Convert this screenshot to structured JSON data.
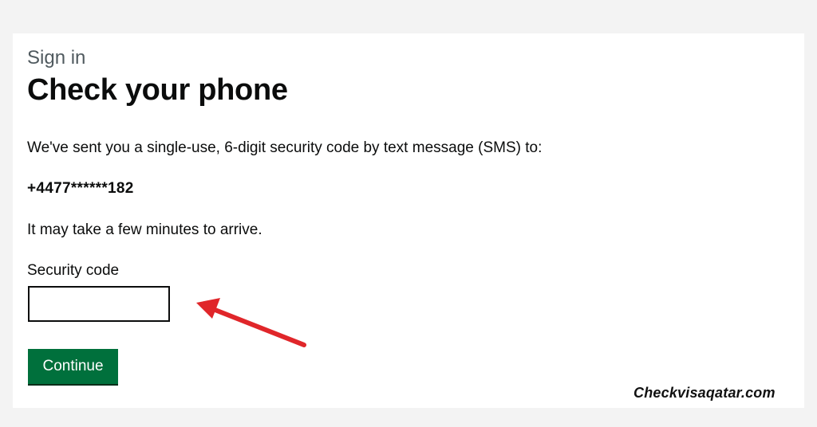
{
  "page": {
    "caption": "Sign in",
    "title": "Check your phone"
  },
  "message": {
    "lead": "We've sent you a single-use, 6-digit security code by text message (SMS) to:",
    "phone_number": "+4477******182",
    "note": "It may take a few minutes to arrive."
  },
  "form": {
    "code_label": "Security code",
    "code_value": "",
    "continue_label": "Continue"
  },
  "annotation": {
    "arrow_icon": "red-arrow-icon",
    "arrow_color": "#e0262a"
  },
  "watermark": {
    "text": "Checkvisaqatar.com"
  },
  "colors": {
    "button_green": "#00703c",
    "text": "#0b0c0c",
    "caption": "#505a5f"
  }
}
